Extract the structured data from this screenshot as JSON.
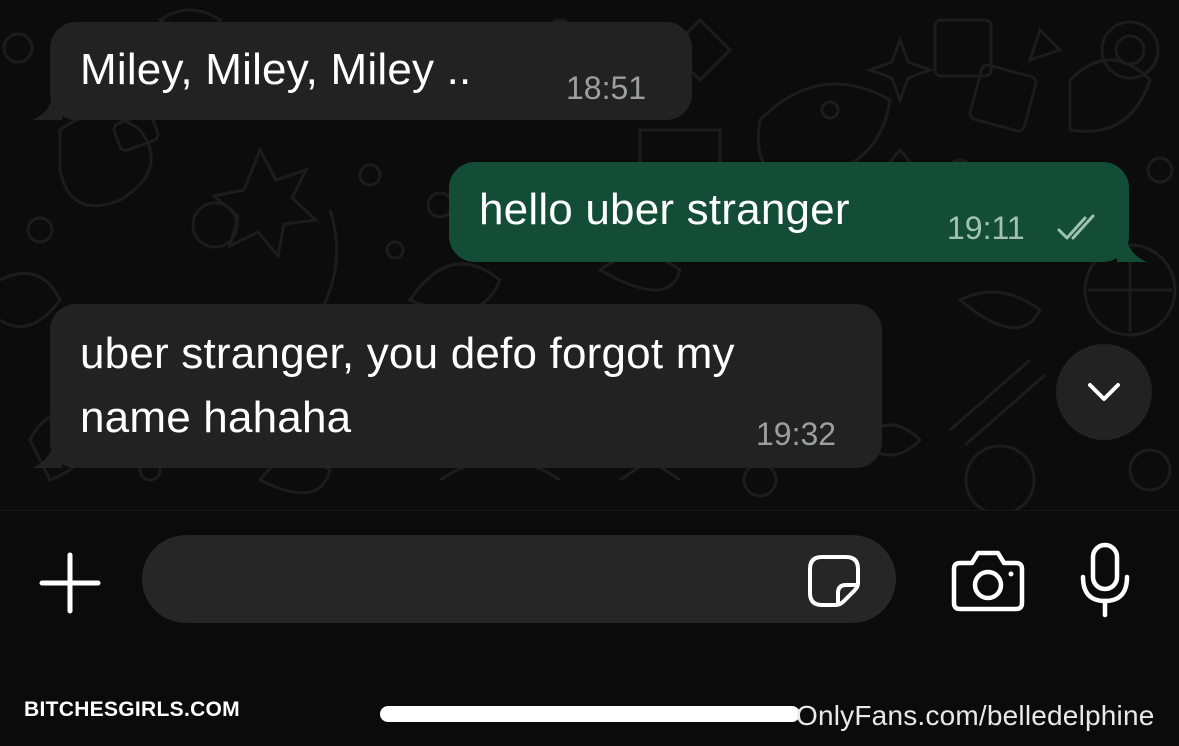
{
  "messages": [
    {
      "direction": "incoming",
      "lines": [
        "Miley, Miley, Miley .."
      ],
      "time": "18:51"
    },
    {
      "direction": "outgoing",
      "lines": [
        "hello uber stranger"
      ],
      "time": "19:11",
      "status_icon": "double-check-icon"
    },
    {
      "direction": "incoming",
      "lines": [
        "uber stranger, you defo forgot my",
        "name hahaha"
      ],
      "time": "19:32"
    }
  ],
  "scroll_button": {
    "icon": "chevron-down-icon"
  },
  "composer": {
    "add_icon": "plus-icon",
    "input_value": "",
    "sticker_icon": "sticker-icon",
    "camera_icon": "camera-icon",
    "mic_icon": "microphone-icon"
  },
  "watermarks": {
    "left": "BITCHESGIRLS.COM",
    "right": "OnlyFans.com/belledelphine"
  },
  "colors": {
    "incoming_bubble": "#222222",
    "outgoing_bubble": "#144d37",
    "background": "#0b0b0b",
    "timestamp": "#9aa0a0"
  }
}
